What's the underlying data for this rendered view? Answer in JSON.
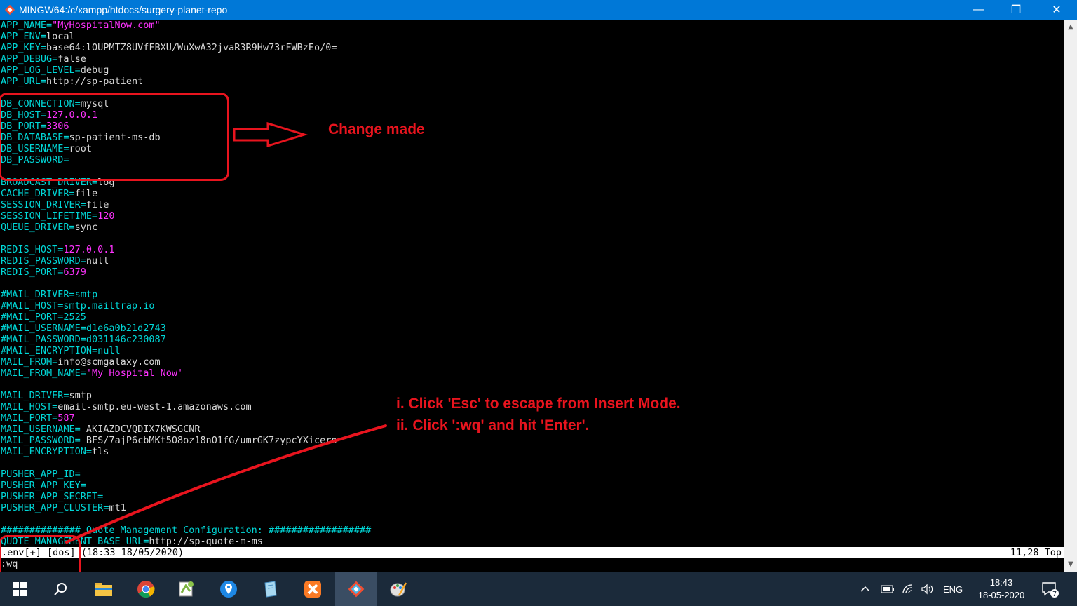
{
  "window": {
    "title": "MINGW64:/c/xampp/htdocs/surgery-planet-repo",
    "minimize_glyph": "—",
    "maximize_glyph": "❐",
    "close_glyph": "✕"
  },
  "editor": {
    "lines": [
      [
        {
          "t": "APP_NAME=",
          "c": "k"
        },
        {
          "t": "\"MyHospitalNow.com\"",
          "c": "s"
        }
      ],
      [
        {
          "t": "APP_ENV=",
          "c": "k"
        },
        {
          "t": "local",
          "c": "v"
        }
      ],
      [
        {
          "t": "APP_KEY=",
          "c": "k"
        },
        {
          "t": "base64:lOUPMTZ8UVfFBXU/WuXwA32jvaR3R9Hw73rFWBzEo/0=",
          "c": "v"
        }
      ],
      [
        {
          "t": "APP_DEBUG=",
          "c": "k"
        },
        {
          "t": "false",
          "c": "v"
        }
      ],
      [
        {
          "t": "APP_LOG_LEVEL=",
          "c": "k"
        },
        {
          "t": "debug",
          "c": "v"
        }
      ],
      [
        {
          "t": "APP_URL=",
          "c": "k"
        },
        {
          "t": "http://sp-patient",
          "c": "v"
        }
      ],
      [],
      [
        {
          "t": "DB_CONNECTION=",
          "c": "k"
        },
        {
          "t": "mysql",
          "c": "v"
        }
      ],
      [
        {
          "t": "DB_HOST=",
          "c": "k"
        },
        {
          "t": "127.0.0.1",
          "c": "n"
        }
      ],
      [
        {
          "t": "DB_PORT=",
          "c": "k"
        },
        {
          "t": "3306",
          "c": "n"
        }
      ],
      [
        {
          "t": "DB_DATABASE=",
          "c": "k"
        },
        {
          "t": "sp-patient-ms-db",
          "c": "v"
        }
      ],
      [
        {
          "t": "DB_USERNAME=",
          "c": "k"
        },
        {
          "t": "root",
          "c": "v"
        }
      ],
      [
        {
          "t": "DB_PASSWORD=",
          "c": "k"
        }
      ],
      [],
      [
        {
          "t": "BROADCAST_DRIVER=",
          "c": "k"
        },
        {
          "t": "log",
          "c": "v"
        }
      ],
      [
        {
          "t": "CACHE_DRIVER=",
          "c": "k"
        },
        {
          "t": "file",
          "c": "v"
        }
      ],
      [
        {
          "t": "SESSION_DRIVER=",
          "c": "k"
        },
        {
          "t": "file",
          "c": "v"
        }
      ],
      [
        {
          "t": "SESSION_LIFETIME=",
          "c": "k"
        },
        {
          "t": "120",
          "c": "n"
        }
      ],
      [
        {
          "t": "QUEUE_DRIVER=",
          "c": "k"
        },
        {
          "t": "sync",
          "c": "v"
        }
      ],
      [],
      [
        {
          "t": "REDIS_HOST=",
          "c": "k"
        },
        {
          "t": "127.0.0.1",
          "c": "n"
        }
      ],
      [
        {
          "t": "REDIS_PASSWORD=",
          "c": "k"
        },
        {
          "t": "null",
          "c": "v"
        }
      ],
      [
        {
          "t": "REDIS_PORT=",
          "c": "k"
        },
        {
          "t": "6379",
          "c": "n"
        }
      ],
      [],
      [
        {
          "t": "#MAIL_DRIVER=smtp",
          "c": "k"
        }
      ],
      [
        {
          "t": "#MAIL_HOST=smtp.mailtrap.io",
          "c": "k"
        }
      ],
      [
        {
          "t": "#MAIL_PORT=2525",
          "c": "k"
        }
      ],
      [
        {
          "t": "#MAIL_USERNAME=d1e6a0b21d2743",
          "c": "k"
        }
      ],
      [
        {
          "t": "#MAIL_PASSWORD=d031146c230087",
          "c": "k"
        }
      ],
      [
        {
          "t": "#MAIL_ENCRYPTION=null",
          "c": "k"
        }
      ],
      [
        {
          "t": "MAIL_FROM=",
          "c": "k"
        },
        {
          "t": "info@scmgalaxy.com",
          "c": "v"
        }
      ],
      [
        {
          "t": "MAIL_FROM_NAME=",
          "c": "k"
        },
        {
          "t": "'My Hospital Now'",
          "c": "s"
        }
      ],
      [],
      [
        {
          "t": "MAIL_DRIVER=",
          "c": "k"
        },
        {
          "t": "smtp",
          "c": "v"
        }
      ],
      [
        {
          "t": "MAIL_HOST=",
          "c": "k"
        },
        {
          "t": "email-smtp.eu-west-1.amazonaws.com",
          "c": "v"
        }
      ],
      [
        {
          "t": "MAIL_PORT=",
          "c": "k"
        },
        {
          "t": "587",
          "c": "n"
        }
      ],
      [
        {
          "t": "MAIL_USERNAME=",
          "c": "k"
        },
        {
          "t": " AKIAZDCVQDIX7KWSGCNR",
          "c": "v"
        }
      ],
      [
        {
          "t": "MAIL_PASSWORD=",
          "c": "k"
        },
        {
          "t": " BFS/7ajP6cbMKt5O8oz18nO1fG/umrGK7zypcYXicern",
          "c": "v"
        }
      ],
      [
        {
          "t": "MAIL_ENCRYPTION=",
          "c": "k"
        },
        {
          "t": "tls",
          "c": "v"
        }
      ],
      [],
      [
        {
          "t": "PUSHER_APP_ID=",
          "c": "k"
        }
      ],
      [
        {
          "t": "PUSHER_APP_KEY=",
          "c": "k"
        }
      ],
      [
        {
          "t": "PUSHER_APP_SECRET=",
          "c": "k"
        }
      ],
      [
        {
          "t": "PUSHER_APP_CLUSTER=",
          "c": "k"
        },
        {
          "t": "mt1",
          "c": "v"
        }
      ],
      [],
      [
        {
          "t": "############## Quote Management Configuration: ##################",
          "c": "k"
        }
      ],
      [
        {
          "t": "QUOTE_MANAGEMENT_BASE_URL=",
          "c": "k"
        },
        {
          "t": "http://sp-quote-m-ms",
          "c": "v"
        }
      ]
    ],
    "status_left": ".env[+] [dos] (18:33 18/05/2020)",
    "status_right": "11,28 Top",
    "command": ":wq"
  },
  "annotations": {
    "change_made": "Change made",
    "step1": "i. Click 'Esc' to escape from Insert Mode.",
    "step2": "ii. Click ':wq' and hit 'Enter'.",
    "color": "#e8141e"
  },
  "taskbar": {
    "apps": [
      "start-icon",
      "search-icon",
      "file-explorer-icon",
      "chrome-icon",
      "notepad-plus-icon",
      "maps-icon",
      "notepad-icon",
      "xampp-icon",
      "git-bash-icon",
      "paint-icon"
    ],
    "language": "ENG",
    "time": "18:43",
    "date": "18-05-2020",
    "notification_count": "7"
  }
}
